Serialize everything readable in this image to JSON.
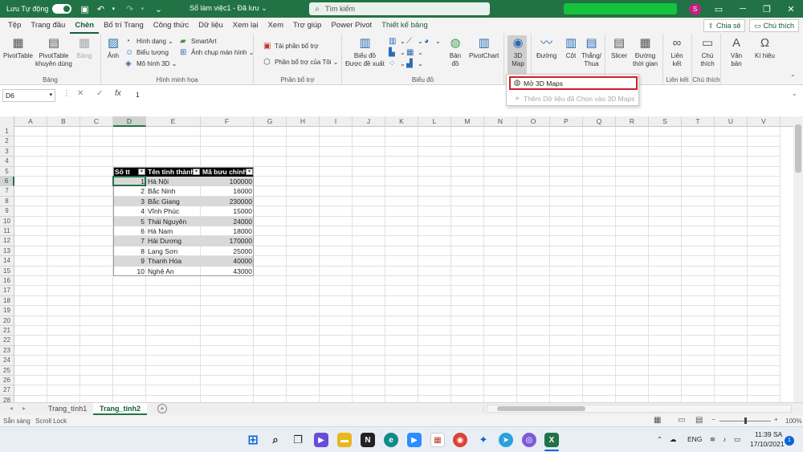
{
  "titlebar": {
    "autosave_label": "Lưu Tự động",
    "doc_title": "Sổ làm việc1  -  Đã lưu",
    "doc_title_caret": "⌄",
    "search_placeholder": "Tìm kiếm",
    "avatar_initial": "S",
    "accent": "#217346"
  },
  "tabs": [
    "Tệp",
    "Trang đầu",
    "Chèn",
    "Bố trí Trang",
    "Công thức",
    "Dữ liệu",
    "Xem lại",
    "Xem",
    "Trợ giúp",
    "Power Pivot",
    "Thiết kế bảng"
  ],
  "tabs_active": "Chèn",
  "share_label": "Chia sẻ",
  "comments_label": "Chú thích",
  "ribbon": {
    "tables": {
      "label": "Bảng",
      "pivottable": "PivotTable",
      "rec_pivot_1": "PivotTable",
      "rec_pivot_2": "khuyên dùng",
      "table": "Bảng"
    },
    "illustrations": {
      "label": "Hình minh họa",
      "pictures": "Ảnh",
      "shapes": "Hình dạng",
      "icons": "Biểu tượng",
      "models": "Mô hình 3D",
      "smartart": "SmartArt",
      "screenshot": "Ảnh chụp màn hình"
    },
    "addins": {
      "label": "Phần bổ trợ",
      "get": "Tải phần bổ trợ",
      "my": "Phần bổ trợ của Tôi"
    },
    "charts": {
      "label": "Biểu đồ",
      "rec_1": "Biểu đồ",
      "rec_2": "Được đề xuất",
      "maps_1": "Bản",
      "maps_2": "đồ",
      "pivotchart": "PivotChart"
    },
    "tours": {
      "map_1": "3D",
      "map_2": "Map"
    },
    "sparklines": {
      "line": "Đường",
      "column": "Cột",
      "winloss_1": "Thắng/",
      "winloss_2": "Thua"
    },
    "filters": {
      "slicer": "Slicer",
      "timeline_1": "Đường",
      "timeline_2": "thời gian"
    },
    "links": {
      "label": "Liên kết",
      "link_1": "Liên",
      "link_2": "kết"
    },
    "comments": {
      "label": "Chú thích",
      "comment_1": "Chú",
      "comment_2": "thích"
    },
    "text": {
      "label": "Văn",
      "label2": "bản"
    },
    "symbols": {
      "label": "Kí hiệu"
    }
  },
  "dropdown": {
    "open": "Mở 3D Maps",
    "add": "Thêm Dữ liệu đã Chọn vào 3D Maps"
  },
  "formula": {
    "namebox": "D6",
    "fx": "fx",
    "content": "1"
  },
  "columns": [
    "A",
    "B",
    "C",
    "D",
    "E",
    "F",
    "G",
    "H",
    "I",
    "J",
    "K",
    "L",
    "M",
    "N",
    "O",
    "P",
    "Q",
    "R",
    "S",
    "T",
    "U",
    "V"
  ],
  "rows": [
    "1",
    "2",
    "3",
    "4",
    "5",
    "6",
    "7",
    "8",
    "9",
    "10",
    "11",
    "12",
    "13",
    "14",
    "15",
    "16",
    "17",
    "18",
    "19",
    "20",
    "21",
    "22",
    "23",
    "24",
    "25",
    "26",
    "27",
    "28"
  ],
  "table": {
    "headers": [
      "Số tt",
      "Tên tỉnh thành",
      "Mã bưu chính"
    ],
    "filter_glyph": "▾",
    "rows": [
      [
        "1",
        "Hà Nội",
        "100000"
      ],
      [
        "2",
        "Bắc Ninh",
        "16000"
      ],
      [
        "3",
        "Bắc Giang",
        "230000"
      ],
      [
        "4",
        "Vĩnh Phúc",
        "15000"
      ],
      [
        "5",
        "Thái Nguyên",
        "24000"
      ],
      [
        "6",
        "Hà Nam",
        "18000"
      ],
      [
        "7",
        "Hải Dương",
        "170000"
      ],
      [
        "8",
        "Lạng Sơn",
        "25000"
      ],
      [
        "9",
        "Thanh Hóa",
        "40000"
      ],
      [
        "10",
        "Nghệ An",
        "43000"
      ]
    ]
  },
  "sheets": [
    "Trang_tính1",
    "Trang_tính2"
  ],
  "sheets_active": "Trang_tính2",
  "status": {
    "ready": "Sẵn sàng",
    "scroll_lock": "Scroll Lock",
    "zoom": "100%"
  },
  "taskbar": {
    "lang": "ENG",
    "time": "11:39 SA",
    "date": "17/10/2021",
    "notif": "1"
  }
}
